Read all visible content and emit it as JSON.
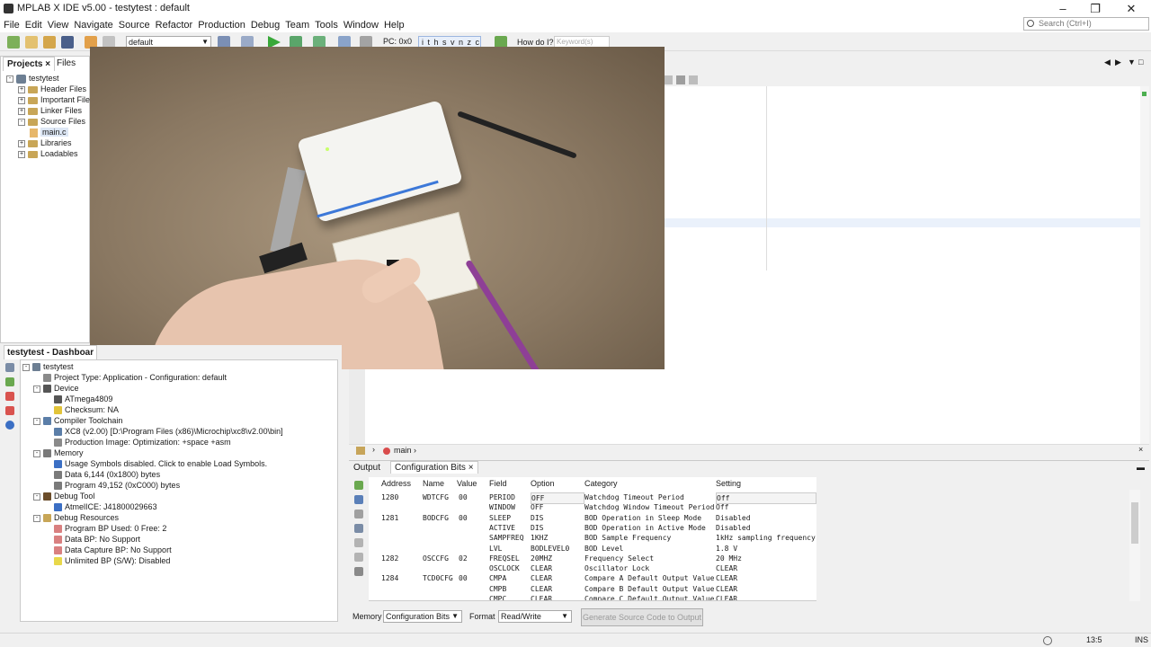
{
  "window": {
    "title": "MPLAB X IDE v5.00 - testytest : default"
  },
  "menu": [
    "File",
    "Edit",
    "View",
    "Navigate",
    "Source",
    "Refactor",
    "Production",
    "Debug",
    "Team",
    "Tools",
    "Window",
    "Help"
  ],
  "search": {
    "placeholder": "Search (Ctrl+I)"
  },
  "toolbar": {
    "config": "default",
    "pc": "PC: 0x0",
    "flags": "i t h s v n z c",
    "howdoi": "How do I?",
    "keyword_placeholder": "Keyword(s)"
  },
  "projects": {
    "tabs": [
      "Projects",
      "Files"
    ],
    "tree": [
      {
        "label": "testytest",
        "indent": 0,
        "kind": "project",
        "exp": "-"
      },
      {
        "label": "Header Files",
        "indent": 1,
        "kind": "folder",
        "exp": "+"
      },
      {
        "label": "Important Files",
        "indent": 1,
        "kind": "folder",
        "exp": "+"
      },
      {
        "label": "Linker Files",
        "indent": 1,
        "kind": "folder",
        "exp": "+"
      },
      {
        "label": "Source Files",
        "indent": 1,
        "kind": "folder",
        "exp": "-"
      },
      {
        "label": "main.c",
        "indent": 2,
        "kind": "file",
        "exp": ""
      },
      {
        "label": "Libraries",
        "indent": 1,
        "kind": "folder",
        "exp": "+"
      },
      {
        "label": "Loadables",
        "indent": 1,
        "kind": "folder",
        "exp": "+"
      }
    ]
  },
  "dashboard": {
    "tab": "testytest - Dashboar",
    "tree": [
      {
        "label": "testytest",
        "indent": 0,
        "exp": "-",
        "color": "#6d7f93"
      },
      {
        "label": "Project Type: Application - Configuration: default",
        "indent": 1,
        "exp": "",
        "color": "#8a8a8a"
      },
      {
        "label": "Device",
        "indent": 1,
        "exp": "-",
        "color": "#555555"
      },
      {
        "label": "ATmega4809",
        "indent": 2,
        "exp": "",
        "color": "#555555"
      },
      {
        "label": "Checksum: NA",
        "indent": 2,
        "exp": "",
        "color": "#e2c43a"
      },
      {
        "label": "Compiler Toolchain",
        "indent": 1,
        "exp": "-",
        "color": "#5b7ea8"
      },
      {
        "label": "XC8 (v2.00) [D:\\Program Files (x86)\\Microchip\\xc8\\v2.00\\bin]",
        "indent": 2,
        "exp": "",
        "color": "#5b7ea8"
      },
      {
        "label": "Production Image: Optimization: +space +asm",
        "indent": 2,
        "exp": "",
        "color": "#8a8a8a"
      },
      {
        "label": "Memory",
        "indent": 1,
        "exp": "-",
        "color": "#7a7a7a"
      },
      {
        "label": "Usage Symbols disabled. Click to enable Load Symbols.",
        "indent": 2,
        "exp": "",
        "color": "#3b6fc4"
      },
      {
        "label": "Data 6,144 (0x1800) bytes",
        "indent": 2,
        "exp": "",
        "color": "#7a7a7a"
      },
      {
        "label": "Program 49,152 (0xC000) bytes",
        "indent": 2,
        "exp": "",
        "color": "#7a7a7a"
      },
      {
        "label": "Debug Tool",
        "indent": 1,
        "exp": "-",
        "color": "#6b4d2a"
      },
      {
        "label": "AtmelICE: J41800029663",
        "indent": 2,
        "exp": "",
        "color": "#3b6fc4"
      },
      {
        "label": "Debug Resources",
        "indent": 1,
        "exp": "-",
        "color": "#c8a657"
      },
      {
        "label": "Program BP Used: 0  Free: 2",
        "indent": 2,
        "exp": "",
        "color": "#d98080"
      },
      {
        "label": "Data BP: No Support",
        "indent": 2,
        "exp": "",
        "color": "#d98080"
      },
      {
        "label": "Data Capture BP: No Support",
        "indent": 2,
        "exp": "",
        "color": "#d98080"
      },
      {
        "label": "Unlimited BP (S/W): Disabled",
        "indent": 2,
        "exp": "",
        "color": "#e8d84a"
      }
    ]
  },
  "editor": {
    "function": "main"
  },
  "output": {
    "tabs": [
      "Output",
      "Configuration Bits"
    ],
    "headers": [
      "Address",
      "Name",
      "Value",
      "Field",
      "Option",
      "Category",
      "Setting"
    ],
    "rows": [
      [
        "1280",
        "WDTCFG",
        "00",
        "PERIOD",
        "OFF",
        "Watchdog Timeout Period",
        "Off"
      ],
      [
        "",
        "",
        "",
        "WINDOW",
        "OFF",
        "Watchdog Window Timeout Period",
        "Off"
      ],
      [
        "1281",
        "BODCFG",
        "00",
        "SLEEP",
        "DIS",
        "BOD Operation in Sleep Mode",
        "Disabled"
      ],
      [
        "",
        "",
        "",
        "ACTIVE",
        "DIS",
        "BOD Operation in Active Mode",
        "Disabled"
      ],
      [
        "",
        "",
        "",
        "SAMPFREQ",
        "1KHZ",
        "BOD Sample Frequency",
        "1kHz sampling frequency"
      ],
      [
        "",
        "",
        "",
        "LVL",
        "BODLEVEL0",
        "BOD Level",
        "1.8 V"
      ],
      [
        "1282",
        "OSCCFG",
        "02",
        "FREQSEL",
        "20MHZ",
        "Frequency Select",
        "20 MHz"
      ],
      [
        "",
        "",
        "",
        "OSCLOCK",
        "CLEAR",
        "Oscillator Lock",
        "CLEAR"
      ],
      [
        "1284",
        "TCD0CFG",
        "00",
        "CMPA",
        "CLEAR",
        "Compare A Default Output Value",
        "CLEAR"
      ],
      [
        "",
        "",
        "",
        "CMPB",
        "CLEAR",
        "Compare B Default Output Value",
        "CLEAR"
      ],
      [
        "",
        "",
        "",
        "CMPC",
        "CLEAR",
        "Compare C Default Output Value",
        "CLEAR"
      ]
    ],
    "memory_label": "Memory",
    "memory_value": "Configuration Bits",
    "format_label": "Format",
    "format_value": "Read/Write",
    "generate_button": "Generate Source Code to Output"
  },
  "status": {
    "position": "13:5",
    "mode": "INS"
  }
}
